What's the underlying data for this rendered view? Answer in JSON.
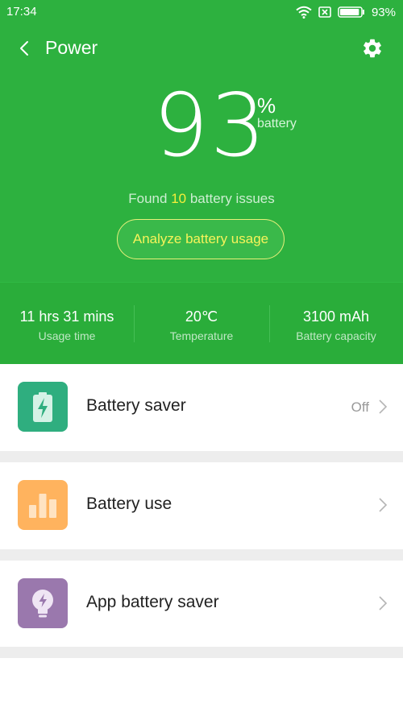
{
  "status_bar": {
    "time": "17:34",
    "battery_percent": "93%",
    "battery_level": 0.93
  },
  "header": {
    "title": "Power"
  },
  "battery": {
    "percent": "93",
    "percent_sign": "%",
    "unit_label": "battery",
    "issues_prefix": "Found ",
    "issues_count": "10",
    "issues_suffix": " battery issues",
    "analyze_label": "Analyze battery usage"
  },
  "stats": [
    {
      "value": "11 hrs 31 mins",
      "label": "Usage time"
    },
    {
      "value": "20℃",
      "label": "Temperature"
    },
    {
      "value": "3100 mAh",
      "label": "Battery capacity"
    }
  ],
  "items": [
    {
      "label": "Battery saver",
      "value": "Off",
      "icon": "battery-charging-icon",
      "color": "#2fae7f"
    },
    {
      "label": "Battery use",
      "icon": "bar-chart-icon",
      "color": "#ffb35e"
    },
    {
      "label": "App battery saver",
      "icon": "lightbulb-icon",
      "color": "#9a78ad"
    }
  ],
  "colors": {
    "primary": "#2db13f",
    "highlight": "#f5ef3a"
  }
}
